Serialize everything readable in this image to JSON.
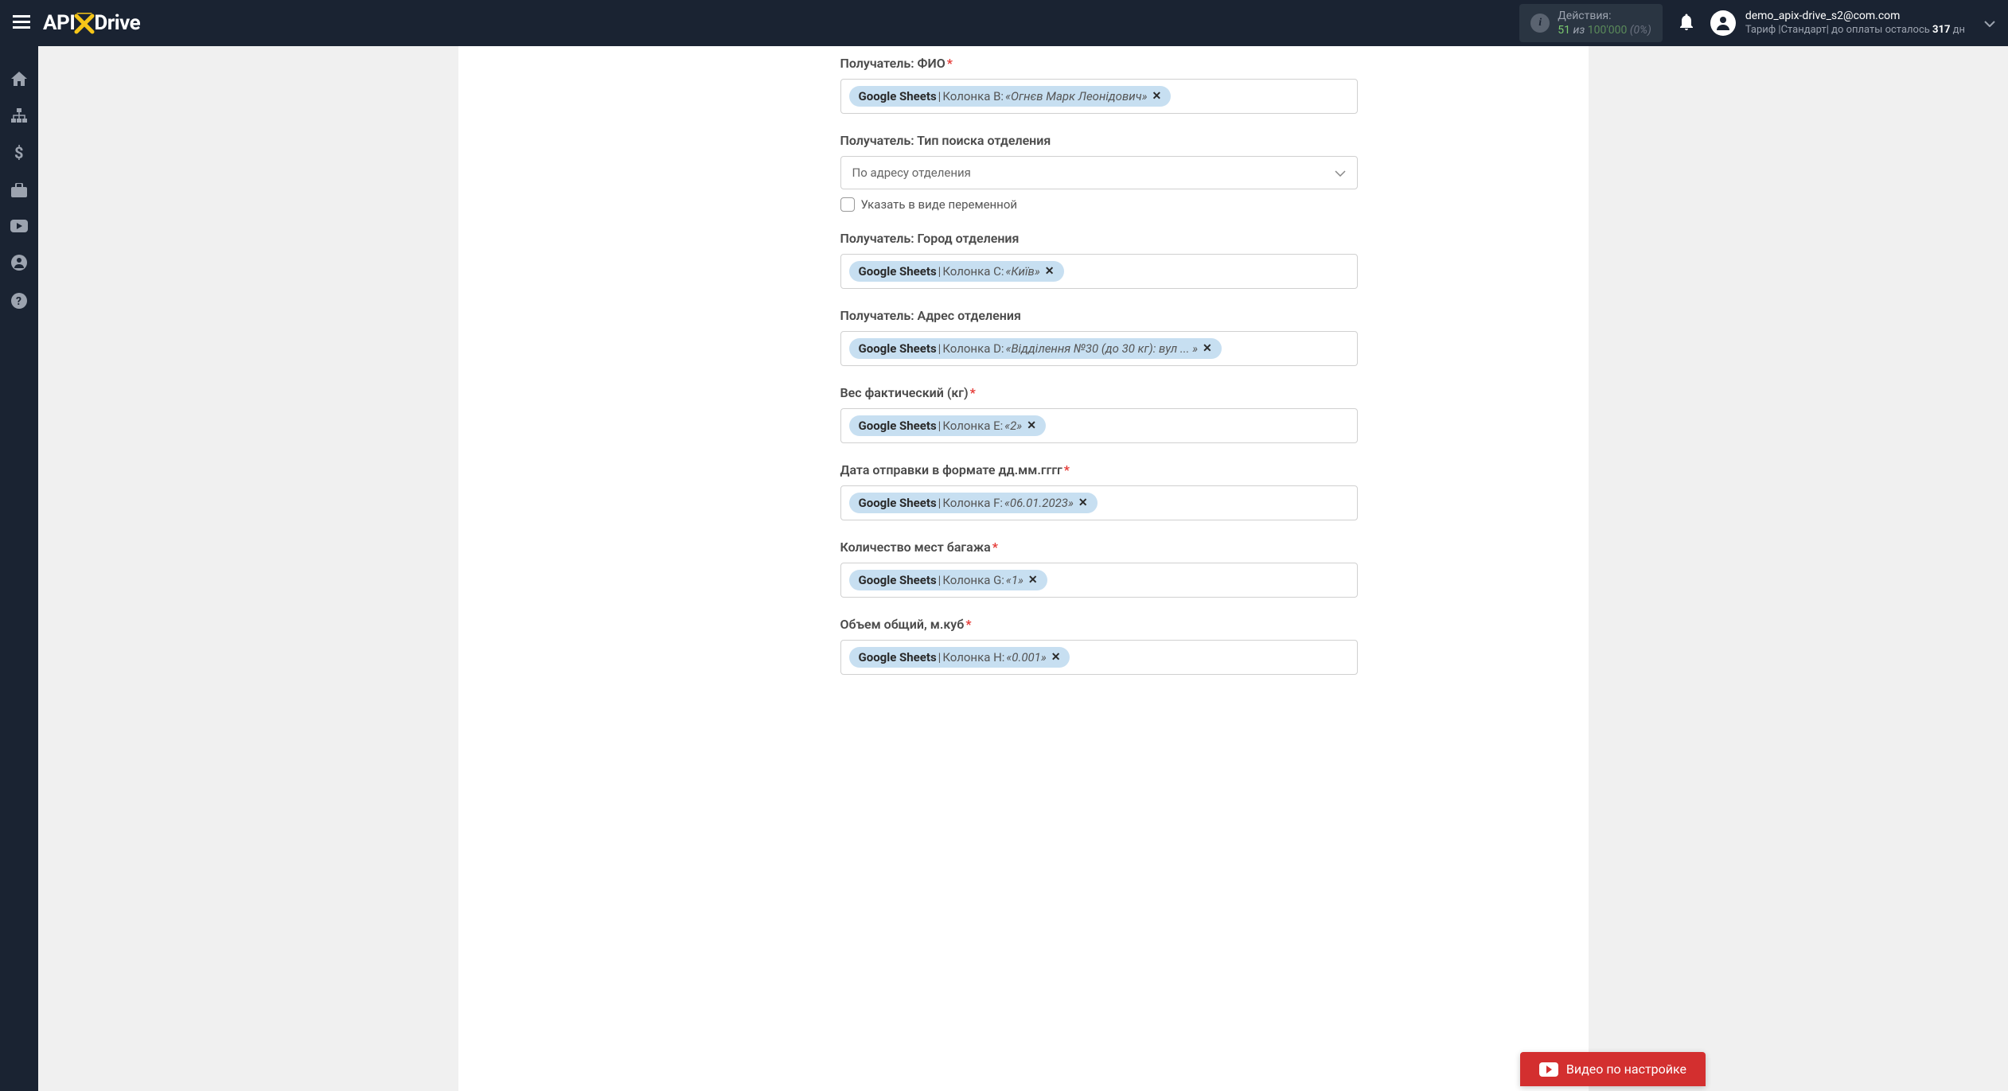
{
  "header": {
    "logo": {
      "api": "API",
      "x": "X",
      "drive": "Drive"
    },
    "actions": {
      "label": "Действия:",
      "value": "51",
      "of": "из",
      "total": "100'000",
      "pct": "(0%)"
    },
    "user": {
      "email": "demo_apix-drive_s2@com.com",
      "tariff_prefix": "Тариф |Стандарт| до оплаты осталось ",
      "days": "317",
      "days_suffix": " дн"
    }
  },
  "fields": [
    {
      "label": "Получатель: ФИО",
      "required": true,
      "type": "token",
      "token": {
        "source": "Google Sheets",
        "column": "Колонка B:",
        "value": "«Огнєв Марк Леонідович»"
      }
    },
    {
      "label": "Получатель: Тип поиска отделения",
      "required": false,
      "type": "select",
      "selected": "По адресу отделения",
      "checkbox_label": "Указать в виде переменной"
    },
    {
      "label": "Получатель: Город отделения",
      "required": false,
      "type": "token",
      "token": {
        "source": "Google Sheets",
        "column": "Колонка C:",
        "value": "«Київ»"
      }
    },
    {
      "label": "Получатель: Адрес отделения",
      "required": false,
      "type": "token",
      "token": {
        "source": "Google Sheets",
        "column": "Колонка D:",
        "value": "«Відділення №30 (до 30 кг): вул ... »"
      }
    },
    {
      "label": "Вес фактический (кг)",
      "required": true,
      "type": "token",
      "token": {
        "source": "Google Sheets",
        "column": "Колонка E:",
        "value": "«2»"
      }
    },
    {
      "label": "Дата отправки в формате дд.мм.гггг",
      "required": true,
      "type": "token",
      "token": {
        "source": "Google Sheets",
        "column": "Колонка F:",
        "value": "«06.01.2023»"
      }
    },
    {
      "label": "Количество мест багажа",
      "required": true,
      "type": "token",
      "token": {
        "source": "Google Sheets",
        "column": "Колонка G:",
        "value": "«1»"
      }
    },
    {
      "label": "Объем общий, м.куб",
      "required": true,
      "type": "token",
      "token": {
        "source": "Google Sheets",
        "column": "Колонка H:",
        "value": "«0.001»"
      }
    }
  ],
  "video_button": "Видео по настройке"
}
